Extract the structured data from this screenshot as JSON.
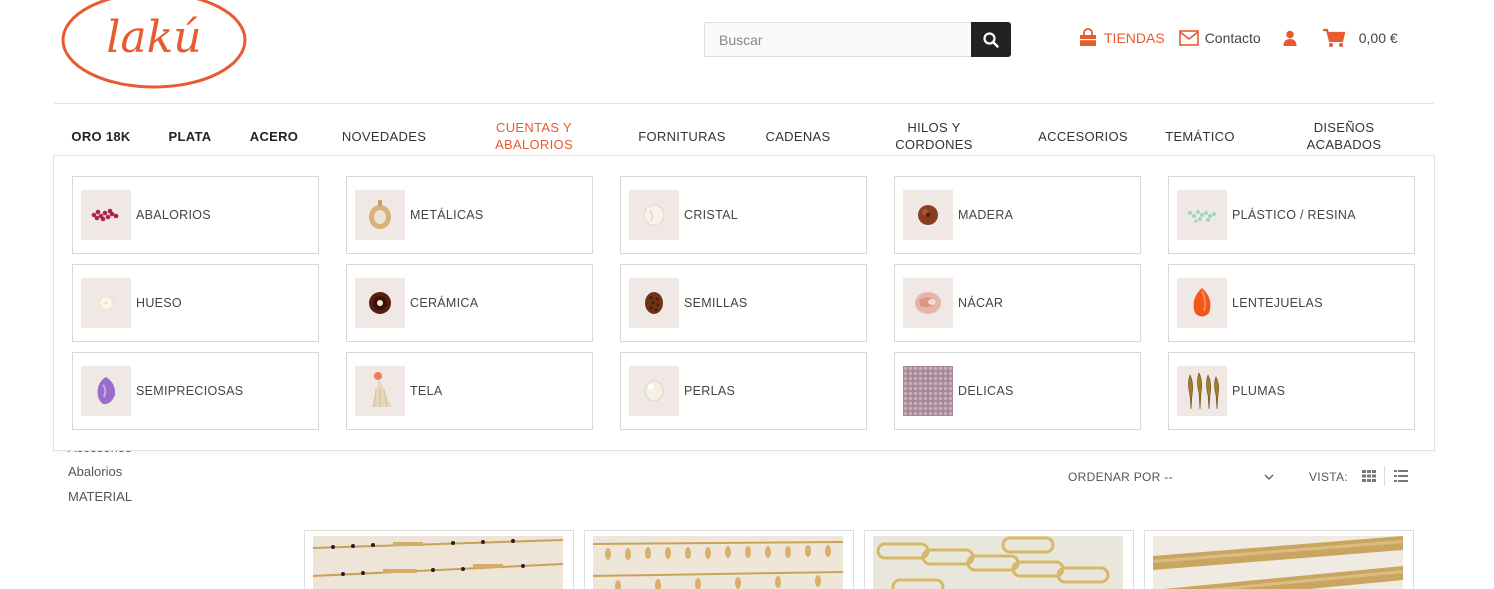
{
  "logo": {
    "text": "lakú",
    "color": "#e85a30"
  },
  "search": {
    "placeholder": "Buscar",
    "button_icon": "search-icon"
  },
  "header_links": {
    "stores": "TIENDAS",
    "contact": "Contacto",
    "cart_total": "0,00 €"
  },
  "nav": [
    {
      "label": "ORO 18K"
    },
    {
      "label": "PLATA"
    },
    {
      "label": "ACERO"
    },
    {
      "label": "NOVEDADES"
    },
    {
      "label": "CUENTAS Y ABALORIOS"
    },
    {
      "label": "FORNITURAS"
    },
    {
      "label": "CADENAS"
    },
    {
      "label": "HILOS Y CORDONES"
    },
    {
      "label": "ACCESORIOS"
    },
    {
      "label": "TEMÁTICO"
    },
    {
      "label": "DISEÑOS ACABADOS"
    }
  ],
  "categories": [
    {
      "label": "ABALORIOS"
    },
    {
      "label": "METÁLICAS"
    },
    {
      "label": "CRISTAL"
    },
    {
      "label": "MADERA"
    },
    {
      "label": "PLÁSTICO / RESINA"
    },
    {
      "label": "HUESO"
    },
    {
      "label": "CERÁMICA"
    },
    {
      "label": "SEMILLAS"
    },
    {
      "label": "NÁCAR"
    },
    {
      "label": "LENTEJUELAS"
    },
    {
      "label": "SEMIPRECIOSAS"
    },
    {
      "label": "TELA"
    },
    {
      "label": "PERLAS"
    },
    {
      "label": "DELICAS"
    },
    {
      "label": "PLUMAS"
    }
  ],
  "sidebar": {
    "partial": "Accesorios",
    "abalorios": "Abalorios",
    "material": "MATERIAL"
  },
  "toolbar": {
    "sort_label": "ORDENAR POR --",
    "view_label": "VISTA:"
  },
  "colors": {
    "accent": "#e85a30",
    "dark": "#222222"
  }
}
